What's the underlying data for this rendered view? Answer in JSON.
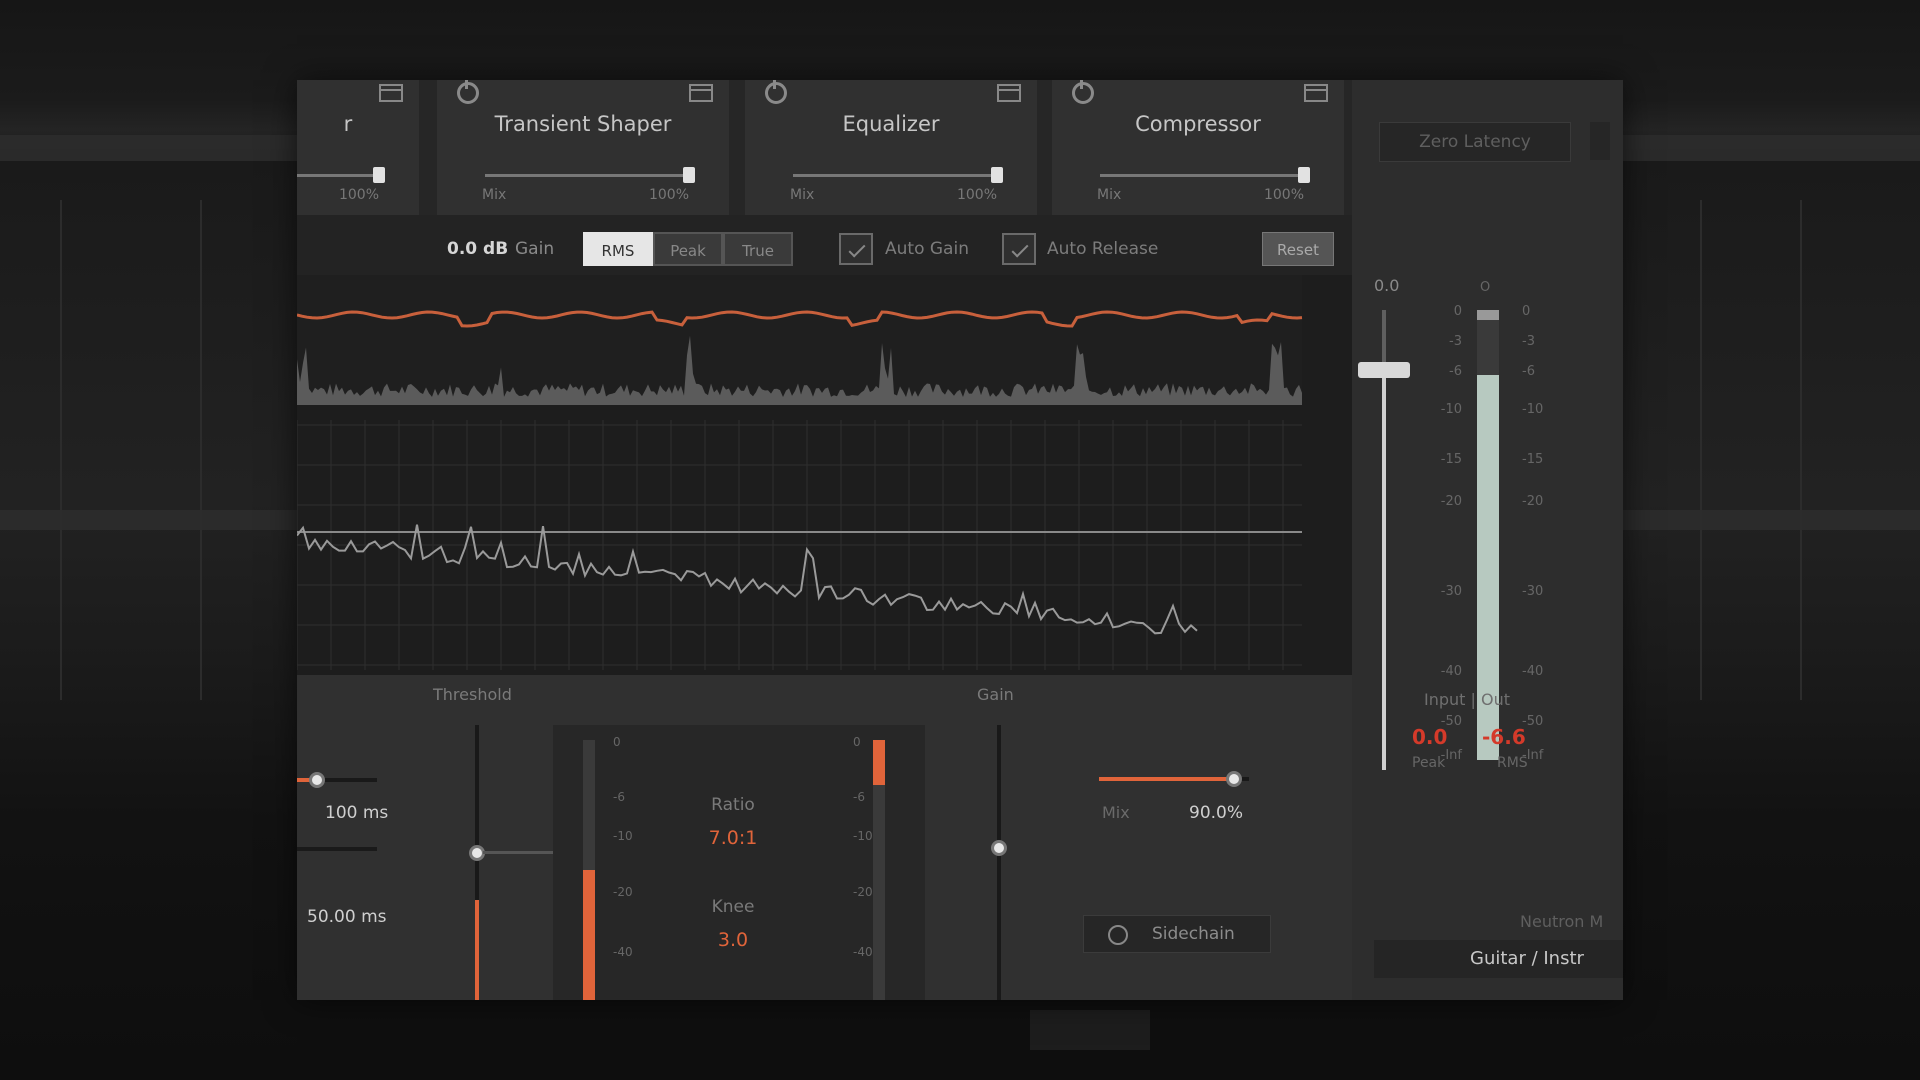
{
  "modules": [
    {
      "title": "r",
      "lo": "",
      "hi": "100%"
    },
    {
      "title": "Transient Shaper",
      "lo": "Mix",
      "hi": "100%"
    },
    {
      "title": "Equalizer",
      "lo": "Mix",
      "hi": "100%"
    },
    {
      "title": "Compressor",
      "lo": "Mix",
      "hi": "100%"
    }
  ],
  "toolbar": {
    "gain_value": "0.0 dB",
    "gain_label": "Gain",
    "detection_modes": [
      "RMS",
      "Peak",
      "True"
    ],
    "active_mode": "RMS",
    "auto_gain_label": "Auto Gain",
    "auto_release_label": "Auto Release",
    "reset_label": "Reset"
  },
  "right_panel": {
    "zero_latency_label": "Zero Latency",
    "fader_value": "0.0",
    "meter_header": "O",
    "meter_scale": [
      "0",
      "-3",
      "-6",
      "-10",
      "-15",
      "-20",
      "-30",
      "-40",
      "-50",
      "-Inf"
    ],
    "io_label": "Input | Out",
    "peak_value": "0.0",
    "rms_value": "-6.6",
    "peak_label": "Peak",
    "rms_label": "RMS",
    "neutron_label": "Neutron M",
    "preset_name": "Guitar / Instr"
  },
  "controls": {
    "threshold_label": "Threshold",
    "gain_label": "Gain",
    "attack_value": "100 ms",
    "release_value": "50.00 ms",
    "ratio_label": "Ratio",
    "ratio_value": "7.0:1",
    "knee_label": "Knee",
    "knee_value": "3.0",
    "comp_scale": [
      "0",
      "-6",
      "-10",
      "-20",
      "-40"
    ],
    "mix_label": "Mix",
    "mix_value": "90.0%",
    "mix_fraction": 0.9,
    "sidechain_label": "Sidechain"
  },
  "colors": {
    "accent": "#e0643a",
    "meter": "#b7c9c0",
    "peak_red": "#d43a2a"
  }
}
